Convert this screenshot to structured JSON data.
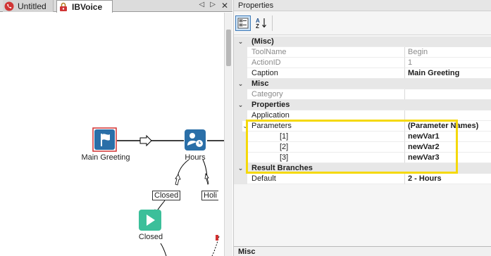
{
  "tabs": [
    {
      "label": "Untitled",
      "icon": "phone-icon"
    },
    {
      "label": "IBVoice",
      "icon": "lock-icon"
    }
  ],
  "designer": {
    "nodes": {
      "main_greeting": "Main Greeting",
      "hours": "Hours",
      "closed": "Closed"
    },
    "branches": {
      "closed": "Closed",
      "holiday_partial": "Holi"
    }
  },
  "properties": {
    "title": "Properties",
    "rows": [
      {
        "kind": "cat",
        "toggle": "⌄",
        "name": "(Misc)",
        "value": ""
      },
      {
        "kind": "ro",
        "name": "ToolName",
        "value": "Begin"
      },
      {
        "kind": "ro",
        "name": "ActionID",
        "value": "1"
      },
      {
        "kind": "prop",
        "name": "Caption",
        "value": "Main Greeting",
        "bold": true
      },
      {
        "kind": "cat",
        "toggle": "⌄",
        "name": "Misc",
        "value": ""
      },
      {
        "kind": "ro",
        "name": "Category",
        "value": ""
      },
      {
        "kind": "cat",
        "toggle": "⌄",
        "name": "Properties",
        "value": ""
      },
      {
        "kind": "prop",
        "name": "Application",
        "value": ""
      },
      {
        "kind": "prop",
        "toggle": "⌄",
        "name": "Parameters",
        "value": "(Parameter Names)",
        "bold": true
      },
      {
        "kind": "sub",
        "name": "[1]",
        "value": "newVar1",
        "bold": true
      },
      {
        "kind": "sub",
        "name": "[2]",
        "value": "newVar2",
        "bold": true
      },
      {
        "kind": "sub",
        "name": "[3]",
        "value": "newVar3",
        "bold": true
      },
      {
        "kind": "cat",
        "toggle": "⌄",
        "name": "Result Branches",
        "value": ""
      },
      {
        "kind": "prop",
        "name": "Default",
        "value": "2 - Hours",
        "bold": true
      }
    ],
    "description_title": "Misc"
  },
  "colors": {
    "accent_blue": "#2a6fa8",
    "highlight_yellow": "#f5d90a",
    "play_green": "#3bbf9a",
    "selection_red": "#d23030"
  }
}
